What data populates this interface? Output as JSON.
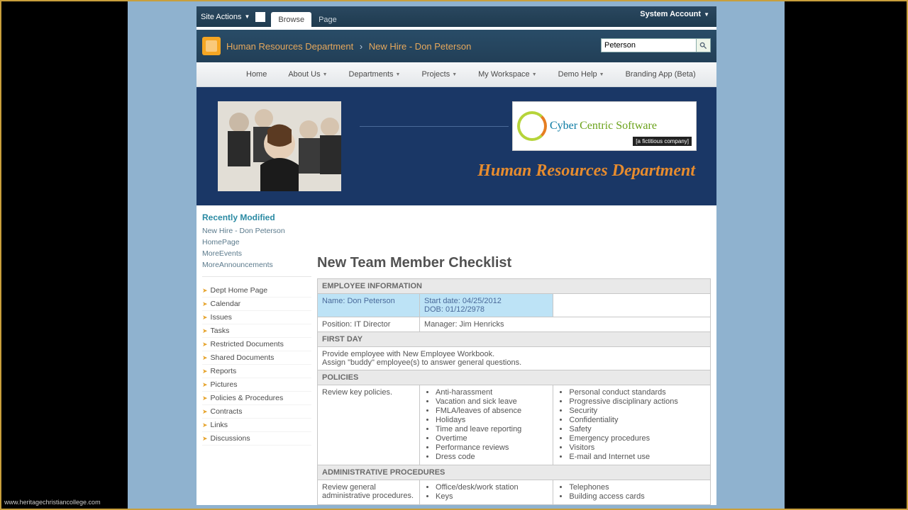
{
  "ribbon": {
    "site_actions": "Site Actions",
    "tab_browse": "Browse",
    "tab_page": "Page",
    "sys_account": "System Account"
  },
  "breadcrumb": {
    "root": "Human Resources Department",
    "sep": "›",
    "leaf": "New Hire - Don Peterson"
  },
  "search": {
    "value": "Peterson"
  },
  "topnav": [
    {
      "label": "Home",
      "dd": false
    },
    {
      "label": "About Us",
      "dd": true
    },
    {
      "label": "Departments",
      "dd": true
    },
    {
      "label": "Projects",
      "dd": true
    },
    {
      "label": "My Workspace",
      "dd": true
    },
    {
      "label": "Demo Help",
      "dd": true
    },
    {
      "label": "Branding App (Beta)",
      "dd": false
    }
  ],
  "hero": {
    "logo_cyber": "Cyber",
    "logo_centric": "Centric Software",
    "fictitious": "[a fictitious company]",
    "dept_title": "Human Resources Department"
  },
  "left": {
    "recently_modified_hdr": "Recently Modified",
    "recent": [
      "New Hire - Don Peterson",
      "HomePage",
      "MoreEvents",
      "MoreAnnouncements"
    ],
    "links": [
      "Dept Home Page",
      "Calendar",
      "Issues",
      "Tasks",
      "Restricted Documents",
      "Shared Documents",
      "Reports",
      "Pictures",
      "Policies & Procedures",
      "Contracts",
      "Links",
      "Discussions"
    ]
  },
  "checklist": {
    "title": "New Team Member Checklist",
    "emp_hdr": "EMPLOYEE INFORMATION",
    "name": "Name: Don Peterson",
    "start": "Start date: 04/25/2012",
    "dob": "DOB:   01/12/2978",
    "position": "Position: IT Director",
    "manager": "Manager: Jim Henricks",
    "first_day_hdr": "FIRST DAY",
    "first_day_1": "Provide employee with New Employee Workbook.",
    "first_day_2": "Assign \"buddy\" employee(s) to answer general questions.",
    "policies_hdr": "POLICIES",
    "policies_intro": "Review key policies.",
    "policies_col2": [
      "Anti-harassment",
      "Vacation and sick leave",
      "FMLA/leaves of absence",
      "Holidays",
      "Time and leave reporting",
      "Overtime",
      "Performance reviews",
      "Dress code"
    ],
    "policies_col3": [
      "Personal conduct standards",
      "Progressive disciplinary actions",
      "Security",
      "Confidentiality",
      "Safety",
      "Emergency procedures",
      "Visitors",
      "E-mail and Internet use"
    ],
    "admin_hdr": "ADMINISTRATIVE PROCEDURES",
    "admin_intro": "Review general administrative procedures.",
    "admin_col2": [
      "Office/desk/work station",
      "Keys"
    ],
    "admin_col3": [
      "Telephones",
      "Building access cards"
    ]
  },
  "watermark": "www.heritagechristiancollege.com"
}
